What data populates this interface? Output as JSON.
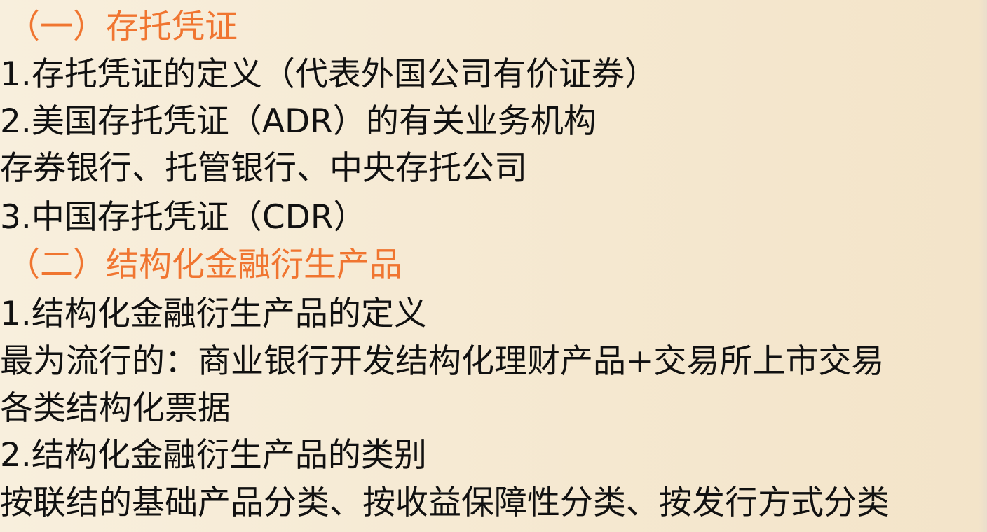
{
  "colors": {
    "background": "#f7ecd7",
    "heading": "#f07530",
    "text": "#111111"
  },
  "lines": [
    {
      "text": "（一）存托凭证",
      "kind": "heading"
    },
    {
      "text": "1.存托凭证的定义（代表外国公司有价证券）",
      "kind": "body"
    },
    {
      "text": "2.美国存托凭证（ADR）的有关业务机构",
      "kind": "body"
    },
    {
      "text": "存券银行、托管银行、中央存托公司",
      "kind": "body"
    },
    {
      "text": "3.中国存托凭证（CDR）",
      "kind": "body"
    },
    {
      "text": "（二）结构化金融衍生产品",
      "kind": "heading"
    },
    {
      "text": "1.结构化金融衍生产品的定义",
      "kind": "body"
    },
    {
      "text": "最为流行的：商业银行开发结构化理财产品+交易所上市交易",
      "kind": "body"
    },
    {
      "text": "各类结构化票据",
      "kind": "body"
    },
    {
      "text": "2.结构化金融衍生产品的类别",
      "kind": "body"
    },
    {
      "text": "按联结的基础产品分类、按收益保障性分类、按发行方式分类",
      "kind": "body"
    }
  ]
}
